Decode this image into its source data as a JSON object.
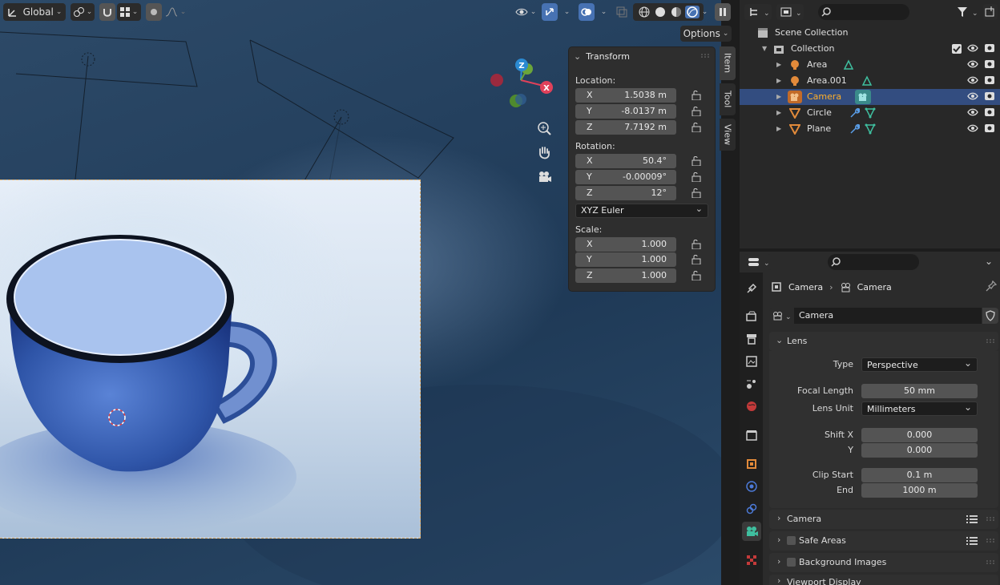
{
  "viewport": {
    "orientation_label": "Global",
    "options_label": "Options",
    "gizmo_axes": {
      "z": "Z",
      "x": "X"
    }
  },
  "n_panel": {
    "title": "Transform",
    "location_label": "Location:",
    "location": [
      {
        "axis": "X",
        "value": "1.5038 m"
      },
      {
        "axis": "Y",
        "value": "-8.0137 m"
      },
      {
        "axis": "Z",
        "value": "7.7192 m"
      }
    ],
    "rotation_label": "Rotation:",
    "rotation": [
      {
        "axis": "X",
        "value": "50.4°"
      },
      {
        "axis": "Y",
        "value": "-0.00009°"
      },
      {
        "axis": "Z",
        "value": "12°"
      }
    ],
    "rotation_mode": "XYZ Euler",
    "scale_label": "Scale:",
    "scale": [
      {
        "axis": "X",
        "value": "1.000"
      },
      {
        "axis": "Y",
        "value": "1.000"
      },
      {
        "axis": "Z",
        "value": "1.000"
      }
    ],
    "tabs": [
      "Item",
      "Tool",
      "View"
    ]
  },
  "outliner": {
    "scene_collection": "Scene Collection",
    "collection": "Collection",
    "items": [
      {
        "name": "Area"
      },
      {
        "name": "Area.001"
      },
      {
        "name": "Camera"
      },
      {
        "name": "Circle"
      },
      {
        "name": "Plane"
      }
    ]
  },
  "properties": {
    "breadcrumb": {
      "object": "Camera",
      "data": "Camera"
    },
    "datablock_name": "Camera",
    "lens_panel": "Lens",
    "type_label": "Type",
    "type_value": "Perspective",
    "focal_length_label": "Focal Length",
    "focal_length_value": "50 mm",
    "lens_unit_label": "Lens Unit",
    "lens_unit_value": "Millimeters",
    "shift_x_label": "Shift X",
    "shift_x_value": "0.000",
    "shift_y_label": "Y",
    "shift_y_value": "0.000",
    "clip_start_label": "Clip Start",
    "clip_start_value": "0.1 m",
    "clip_end_label": "End",
    "clip_end_value": "1000 m",
    "sub_panels": [
      "Camera",
      "Safe Areas",
      "Background Images",
      "Viewport Display"
    ]
  },
  "colors": {
    "selection": "#334d80",
    "active_name": "#ffaf29",
    "accent_blue": "#4772b3",
    "camera_frame": "#e9b977"
  }
}
